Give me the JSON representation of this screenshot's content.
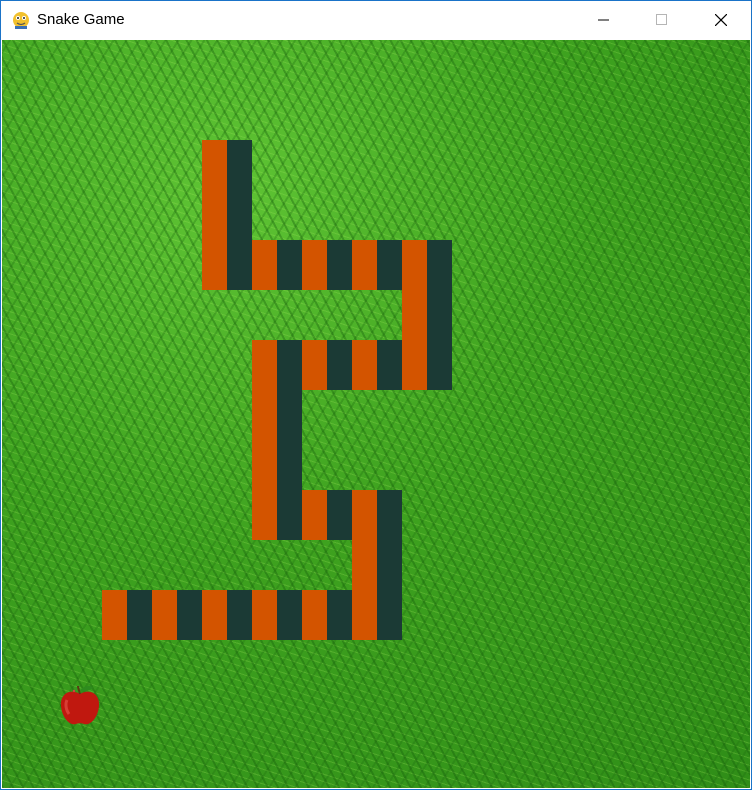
{
  "window": {
    "title": "Snake Game",
    "app_icon": "pygame-snake-icon",
    "controls": [
      "minimize-icon",
      "maximize-icon",
      "close-icon"
    ]
  },
  "colors": {
    "snake_stripe_a": "#d35400",
    "snake_stripe_b": "#1b3a35",
    "grass": "#3ea21f",
    "apple": "#c0180f"
  },
  "game": {
    "grid_unit": "50x50",
    "food": "apple",
    "snake_cells": [
      {
        "col": 4,
        "row": 2
      },
      {
        "col": 4,
        "row": 3
      },
      {
        "col": 4,
        "row": 4
      },
      {
        "col": 5,
        "row": 4
      },
      {
        "col": 6,
        "row": 4
      },
      {
        "col": 7,
        "row": 4
      },
      {
        "col": 8,
        "row": 4
      },
      {
        "col": 8,
        "row": 5
      },
      {
        "col": 8,
        "row": 6
      },
      {
        "col": 7,
        "row": 6
      },
      {
        "col": 6,
        "row": 6
      },
      {
        "col": 5,
        "row": 6
      },
      {
        "col": 5,
        "row": 7
      },
      {
        "col": 5,
        "row": 8
      },
      {
        "col": 5,
        "row": 9
      },
      {
        "col": 6,
        "row": 9
      },
      {
        "col": 7,
        "row": 9
      },
      {
        "col": 7,
        "row": 10
      },
      {
        "col": 7,
        "row": 11
      },
      {
        "col": 6,
        "row": 11
      },
      {
        "col": 5,
        "row": 11
      },
      {
        "col": 4,
        "row": 11
      },
      {
        "col": 3,
        "row": 11
      },
      {
        "col": 2,
        "row": 11
      }
    ],
    "apple_cell": {
      "col": 1,
      "row": 13
    }
  }
}
